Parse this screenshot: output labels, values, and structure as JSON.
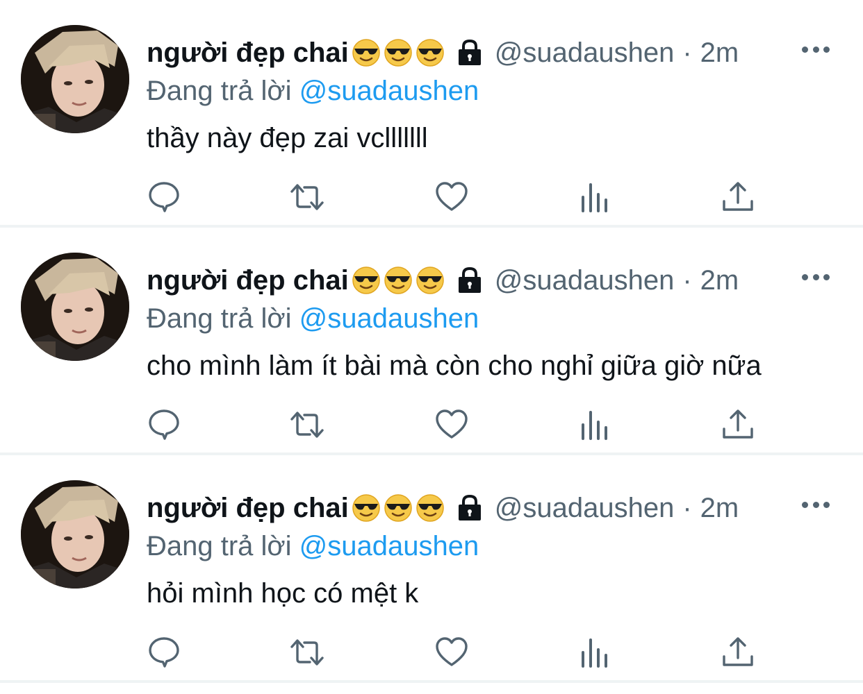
{
  "tweets": [
    {
      "name": "người đẹp chai",
      "handle": "@suadaushen",
      "separator": "·",
      "time": "2m",
      "reply_prefix": "Đang trả lời",
      "reply_mention": "@suadaushen",
      "text": "thầy này đẹp zai vclllllll"
    },
    {
      "name": "người đẹp chai",
      "handle": "@suadaushen",
      "separator": "·",
      "time": "2m",
      "reply_prefix": "Đang trả lời",
      "reply_mention": "@suadaushen",
      "text": "cho mình làm ít bài mà còn cho nghỉ giữa giờ nữa"
    },
    {
      "name": "người đẹp chai",
      "handle": "@suadaushen",
      "separator": "·",
      "time": "2m",
      "reply_prefix": "Đang trả lời",
      "reply_mention": "@suadaushen",
      "text": "hỏi mình học có mệt k"
    }
  ],
  "icons": {
    "name_emoji": "smiling-face-with-sunglasses-icon",
    "protected": "lock-icon",
    "more": "more-icon",
    "reply": "reply-icon",
    "retweet": "retweet-icon",
    "like": "like-icon",
    "views": "analytics-icon",
    "share": "share-icon"
  },
  "colors": {
    "text": "#0f1419",
    "secondary": "#536471",
    "mention": "#1d9bf0",
    "divider": "#eff3f4"
  }
}
